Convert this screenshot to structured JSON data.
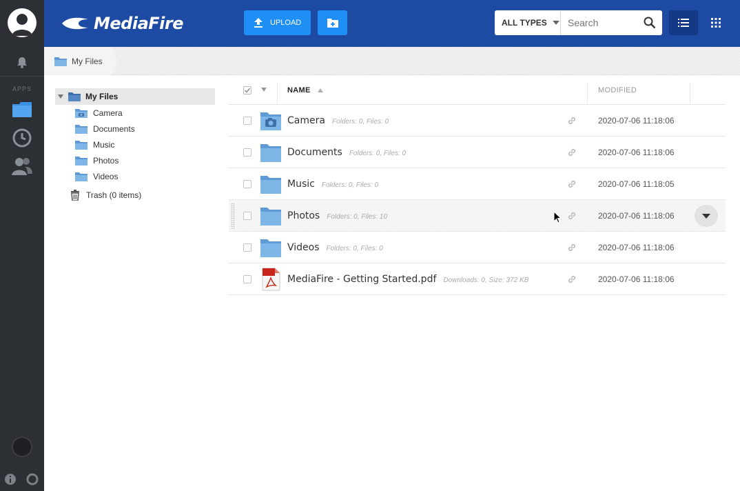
{
  "colors": {
    "topbar": "#1d4aa3",
    "accent": "#1f8ff5",
    "rail": "#2c2f33",
    "folder": "#6aa9e0"
  },
  "rail": {
    "apps_label": "APPS",
    "icons": [
      "avatar-icon",
      "bell-icon",
      "folder-icon",
      "clock-icon",
      "contacts-icon",
      "power-icon",
      "info-icon",
      "help-icon"
    ]
  },
  "header": {
    "logo_text": "MediaFire",
    "upload_label": "UPLOAD",
    "type_filter": "ALL TYPES",
    "search_placeholder": "Search"
  },
  "breadcrumb": {
    "label": "My Files"
  },
  "tree": {
    "root": "My Files",
    "items": [
      "Camera",
      "Documents",
      "Music",
      "Photos",
      "Videos"
    ],
    "trash": "Trash (0 items)"
  },
  "list": {
    "col_name": "NAME",
    "col_modified": "MODIFIED",
    "rows": [
      {
        "name": "Camera",
        "meta": "Folders: 0, Files: 0",
        "modified": "2020-07-06 11:18:06",
        "icon": "camera-folder-icon"
      },
      {
        "name": "Documents",
        "meta": "Folders: 0, Files: 0",
        "modified": "2020-07-06 11:18:06",
        "icon": "folder-icon"
      },
      {
        "name": "Music",
        "meta": "Folders: 0, Files: 0",
        "modified": "2020-07-06 11:18:05",
        "icon": "folder-icon"
      },
      {
        "name": "Photos",
        "meta": "Folders: 0, Files: 10",
        "modified": "2020-07-06 11:18:06",
        "icon": "folder-icon"
      },
      {
        "name": "Videos",
        "meta": "Folders: 0, Files: 0",
        "modified": "2020-07-06 11:18:06",
        "icon": "folder-icon"
      },
      {
        "name": "MediaFire - Getting Started.pdf",
        "meta": "Downloads: 0, Size: 372 KB",
        "modified": "2020-07-06 11:18:06",
        "icon": "pdf-icon"
      }
    ]
  }
}
